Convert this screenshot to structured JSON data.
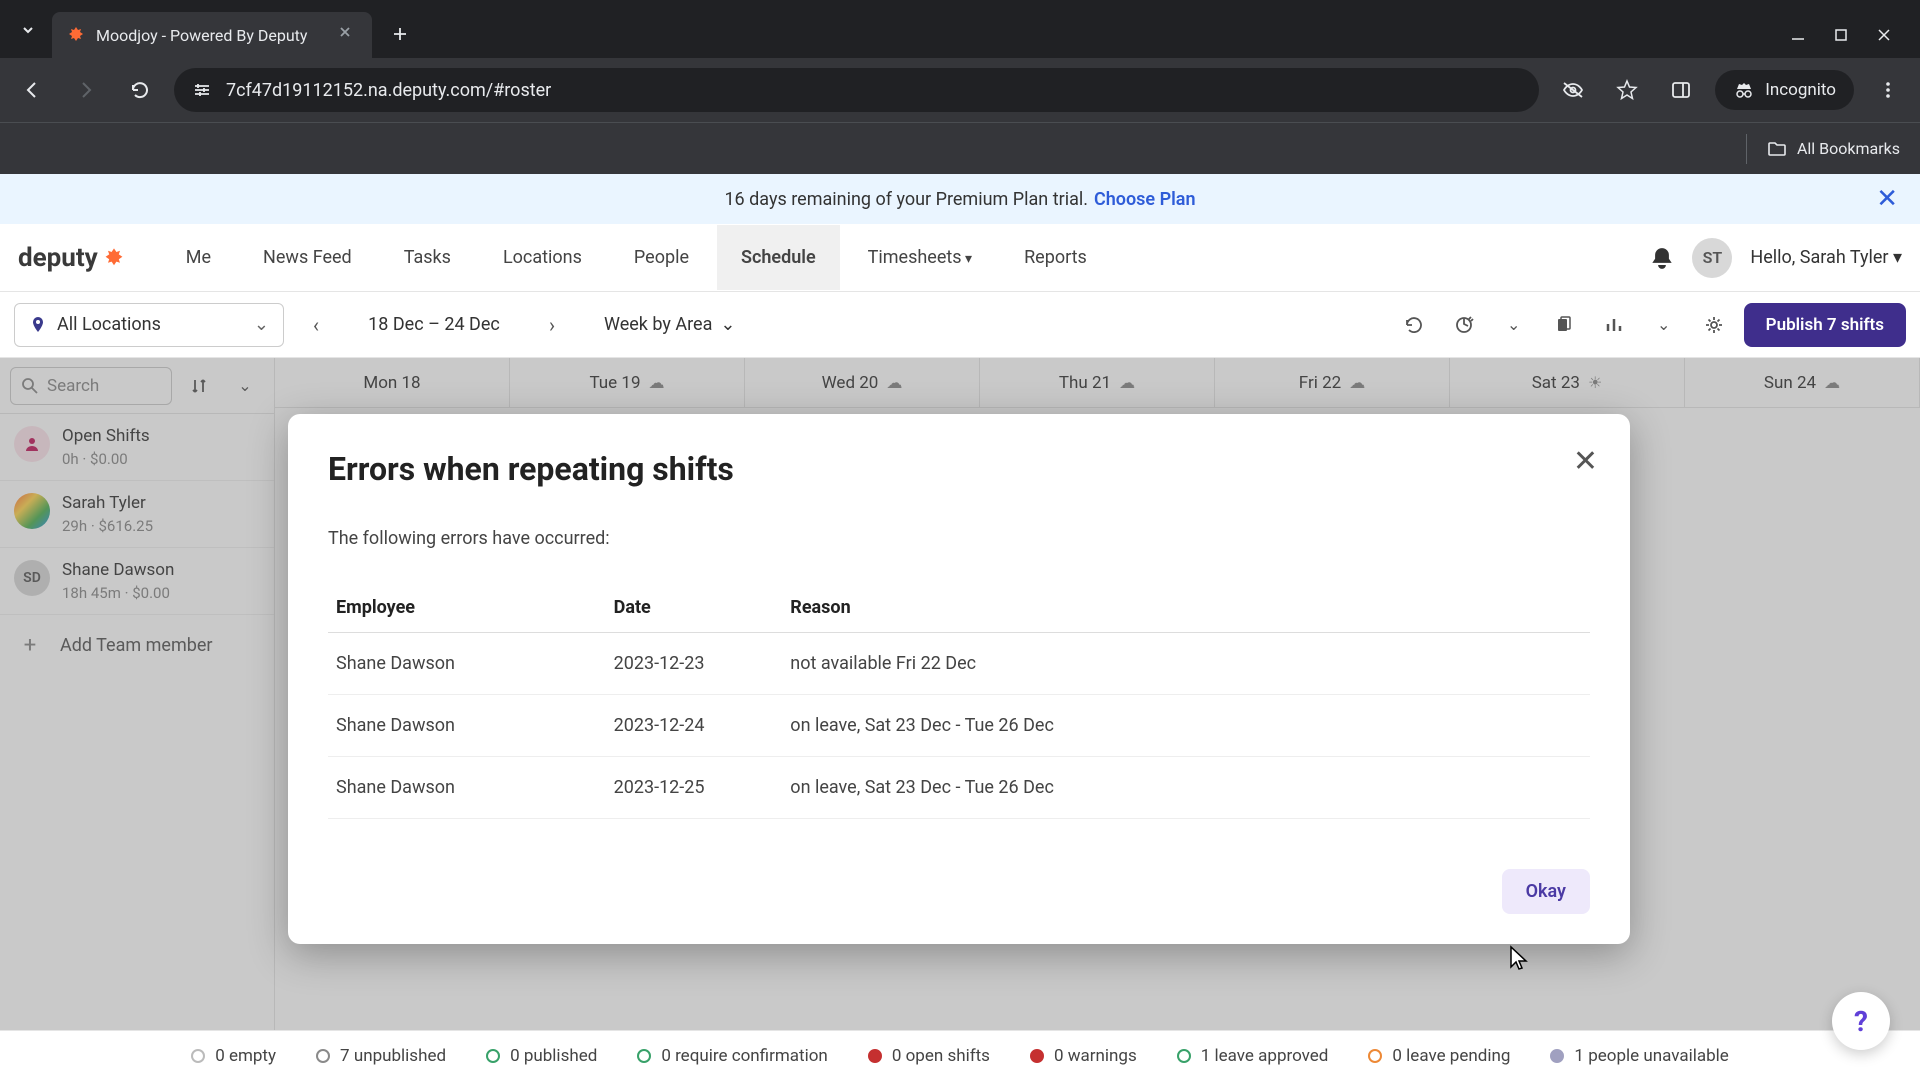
{
  "browser": {
    "tab_title": "Moodjoy - Powered By Deputy",
    "url": "7cf47d19112152.na.deputy.com/#roster",
    "incognito_label": "Incognito",
    "bookmarks_label": "All Bookmarks"
  },
  "trial": {
    "text": "16 days remaining of your Premium Plan trial.",
    "link": "Choose Plan"
  },
  "logo": "deputy",
  "nav": {
    "me": "Me",
    "news": "News Feed",
    "tasks": "Tasks",
    "locations": "Locations",
    "people": "People",
    "schedule": "Schedule",
    "timesheets": "Timesheets",
    "reports": "Reports"
  },
  "user": {
    "initials": "ST",
    "greeting": "Hello, Sarah Tyler"
  },
  "toolbar": {
    "locations": "All Locations",
    "date_range": "18 Dec – 24 Dec",
    "view": "Week by Area",
    "publish": "Publish 7 shifts"
  },
  "search_placeholder": "Search",
  "side": [
    {
      "name": "Open Shifts",
      "meta": "0h · $0.00"
    },
    {
      "name": "Sarah Tyler",
      "meta": "29h · $616.25"
    },
    {
      "name": "Shane Dawson",
      "meta": "18h 45m · $0.00"
    }
  ],
  "add_member": "Add Team member",
  "days": [
    {
      "label": "Mon 18",
      "icon": ""
    },
    {
      "label": "Tue 19",
      "icon": "☁"
    },
    {
      "label": "Wed 20",
      "icon": "☁"
    },
    {
      "label": "Thu 21",
      "icon": "☁"
    },
    {
      "label": "Fri 22",
      "icon": "☁"
    },
    {
      "label": "Sat 23",
      "icon": "☀"
    },
    {
      "label": "Sun 24",
      "icon": "☁"
    }
  ],
  "modal": {
    "title": "Errors when repeating shifts",
    "subtitle": "The following errors have occurred:",
    "cols": {
      "employee": "Employee",
      "date": "Date",
      "reason": "Reason"
    },
    "rows": [
      {
        "employee": "Shane Dawson",
        "date": "2023-12-23",
        "reason": "not available Fri 22 Dec"
      },
      {
        "employee": "Shane Dawson",
        "date": "2023-12-24",
        "reason": "on leave, Sat 23 Dec - Tue 26 Dec"
      },
      {
        "employee": "Shane Dawson",
        "date": "2023-12-25",
        "reason": "on leave, Sat 23 Dec - Tue 26 Dec"
      }
    ],
    "okay": "Okay"
  },
  "status": [
    {
      "color": "#bbb",
      "label": "0 empty"
    },
    {
      "color": "#8a8a8a",
      "label": "7 unpublished"
    },
    {
      "color": "#38a169",
      "label": "0 published"
    },
    {
      "color": "#38a169",
      "label": "0 require confirmation"
    },
    {
      "color": "#c53030",
      "label": "0 open shifts",
      "fill": true
    },
    {
      "color": "#c53030",
      "label": "0 warnings",
      "fill": true
    },
    {
      "color": "#38a169",
      "label": "1 leave approved"
    },
    {
      "color": "#ed8936",
      "label": "0 leave pending"
    },
    {
      "color": "#a0a0c0",
      "label": "1 people unavailable",
      "fill": true
    }
  ]
}
